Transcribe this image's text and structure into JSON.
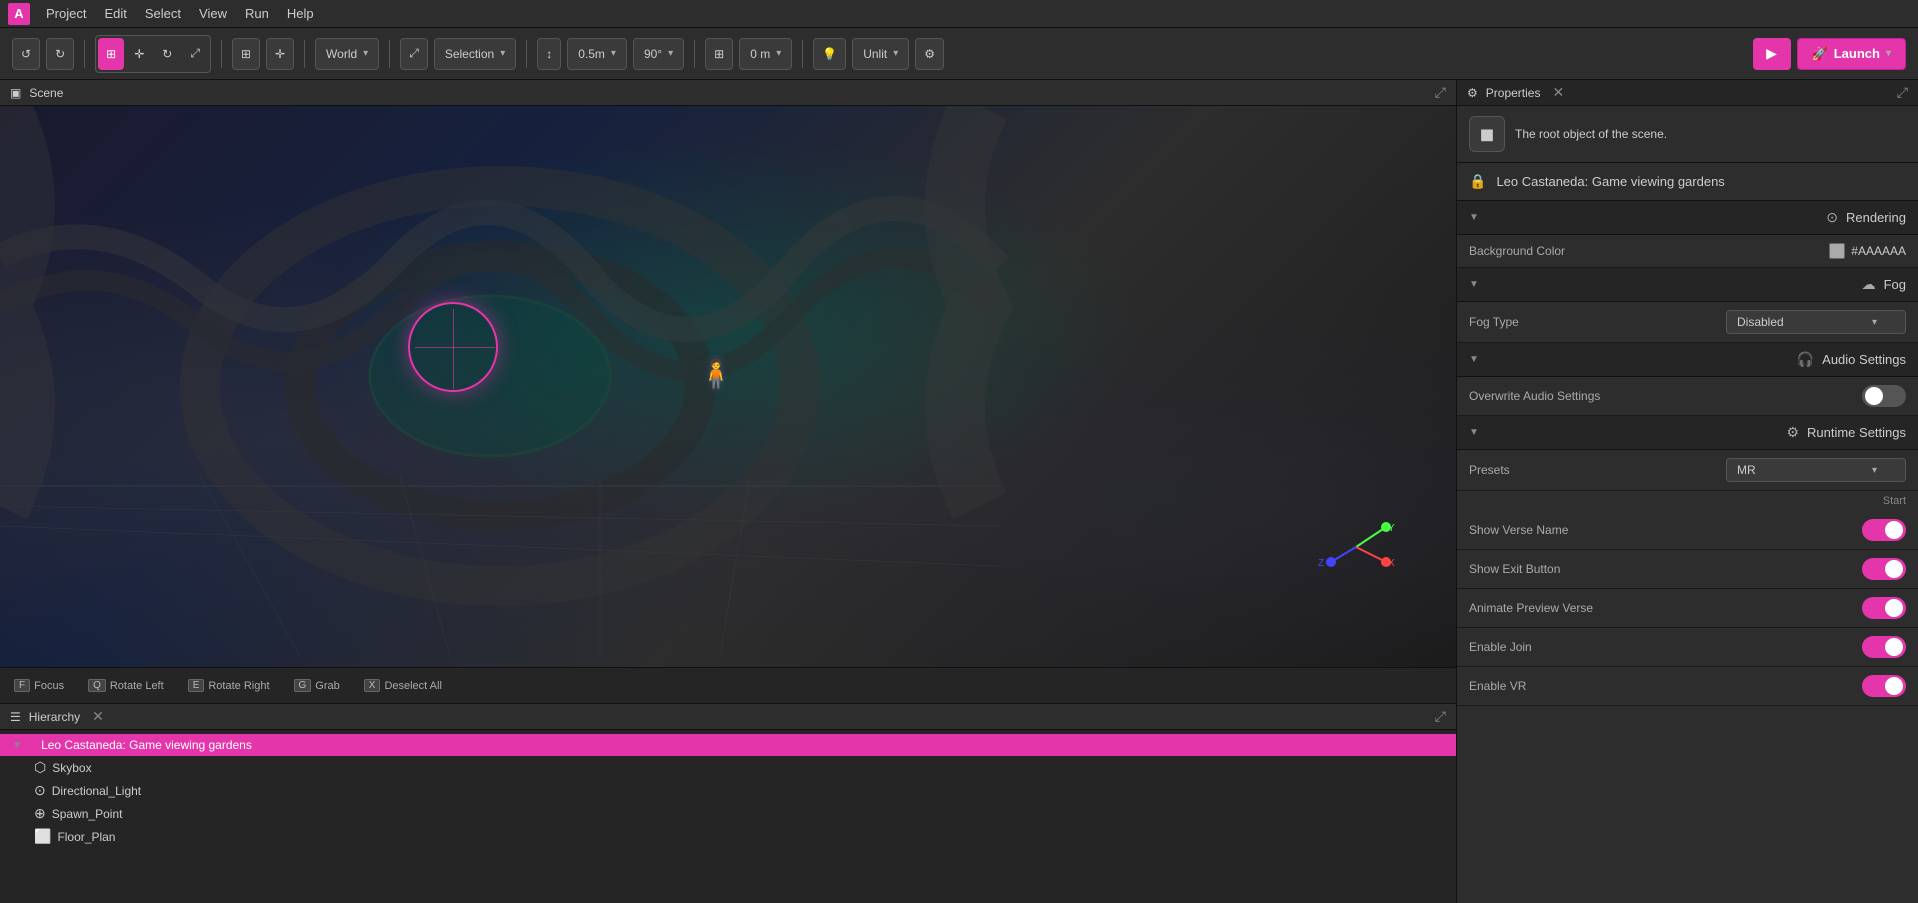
{
  "app": {
    "icon": "A",
    "menu_items": [
      "Project",
      "Edit",
      "Select",
      "View",
      "Run",
      "Help"
    ]
  },
  "toolbar": {
    "undo_label": "↺",
    "redo_label": "↻",
    "transform_modes": [
      "⊞",
      "✛",
      "↻",
      "⤢"
    ],
    "world_label": "World",
    "selection_label": "Selection",
    "snap_value": "0.5m",
    "angle_value": "90°",
    "height_value": "0 m",
    "unlit_label": "Unlit",
    "play_icon": "▶",
    "launch_icon": "🚀",
    "launch_label": "Launch"
  },
  "scene_panel": {
    "title": "Scene",
    "maximize_icon": "⤢",
    "actions": [
      {
        "key": "F",
        "label": "Focus"
      },
      {
        "key": "Q",
        "label": "Rotate Left"
      },
      {
        "key": "E",
        "label": "Rotate Right"
      },
      {
        "key": "G",
        "label": "Grab"
      },
      {
        "key": "X",
        "label": "Deselect All"
      }
    ]
  },
  "hierarchy_panel": {
    "title": "Hierarchy",
    "items": [
      {
        "id": "root",
        "label": "Leo Castaneda: Game viewing gardens",
        "icon": "♦",
        "level": 0,
        "selected": true,
        "expanded": true
      },
      {
        "id": "skybox",
        "label": "Skybox",
        "icon": "⬡",
        "level": 1
      },
      {
        "id": "dir_light",
        "label": "Directional_Light",
        "icon": "☀",
        "level": 1
      },
      {
        "id": "spawn_point",
        "label": "Spawn_Point",
        "icon": "⊕",
        "level": 1
      },
      {
        "id": "floor_plan",
        "label": "Floor_Plan",
        "icon": "⬜",
        "level": 1
      }
    ]
  },
  "properties_panel": {
    "title": "Properties",
    "scene_object_desc": "The root object of the scene.",
    "scene_name": "Leo Castaneda: Game viewing gardens",
    "sections": {
      "rendering": {
        "label": "Rendering",
        "icon": "⊙",
        "background_color_label": "Background Color",
        "background_color_value": "#AAAAAA",
        "background_color_hex": "#aaaaaa"
      },
      "fog": {
        "label": "Fog",
        "icon": "☁",
        "fog_type_label": "Fog Type",
        "fog_type_value": "Disabled"
      },
      "audio_settings": {
        "label": "Audio Settings",
        "icon": "🎧",
        "overwrite_label": "Overwrite Audio Settings",
        "overwrite_on": false
      },
      "runtime_settings": {
        "label": "Runtime Settings",
        "icon": "⚙",
        "presets_label": "Presets",
        "presets_value": "MR",
        "start_label": "Start",
        "toggles": [
          {
            "id": "show_verse_name",
            "label": "Show Verse Name",
            "on": true
          },
          {
            "id": "show_exit_button",
            "label": "Show Exit Button",
            "on": true
          },
          {
            "id": "animate_preview_verse",
            "label": "Animate Preview Verse",
            "on": true
          },
          {
            "id": "enable_join",
            "label": "Enable Join",
            "on": true
          },
          {
            "id": "enable_vr",
            "label": "Enable VR",
            "on": true
          }
        ]
      }
    }
  }
}
